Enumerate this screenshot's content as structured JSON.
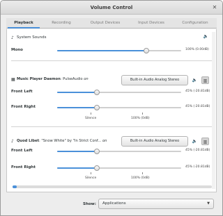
{
  "window": {
    "title": "Volume Control",
    "close_glyph": "✕"
  },
  "tabs": [
    {
      "label": "Playback"
    },
    {
      "label": "Recording"
    },
    {
      "label": "Output Devices"
    },
    {
      "label": "Input Devices"
    },
    {
      "label": "Configuration"
    }
  ],
  "system_sounds": {
    "label": "System Sounds",
    "channel": "Mono",
    "value_text": "100% (0.00dB)",
    "level": 0.72,
    "icon": "speaker-icon"
  },
  "mpd": {
    "name": "Music Player Daemon",
    "detail": ": PulseAudio",
    "on": "on",
    "device_button": "Built-in Audio Analog Stereo",
    "channels": [
      {
        "label": "Front Left",
        "value_text": "45% (-20.81dB)",
        "level": 0.32
      },
      {
        "label": "Front Right",
        "value_text": "45% (-20.81dB)",
        "level": 0.32
      }
    ],
    "scale": {
      "silence": "Silence",
      "full": "100% (0dB)"
    }
  },
  "quod": {
    "name": "Quod Libet",
    "detail": ": \"Snow White\" by \"In Strict Conf...",
    "on": "on",
    "device_button": "Built-in Audio Analog Stereo",
    "channels": [
      {
        "label": "Front Left",
        "value_text": "45% (-20.81dB)",
        "level": 0.32
      },
      {
        "label": "Front Right",
        "value_text": "45% (-20.81dB)",
        "level": 0.32
      }
    ],
    "scale": {
      "silence": "Silence",
      "full": "100% (0dB)"
    }
  },
  "footer": {
    "show_label": "Show:",
    "show_value": "Applications",
    "arrow": "▼"
  },
  "accent": "#4a90d9"
}
